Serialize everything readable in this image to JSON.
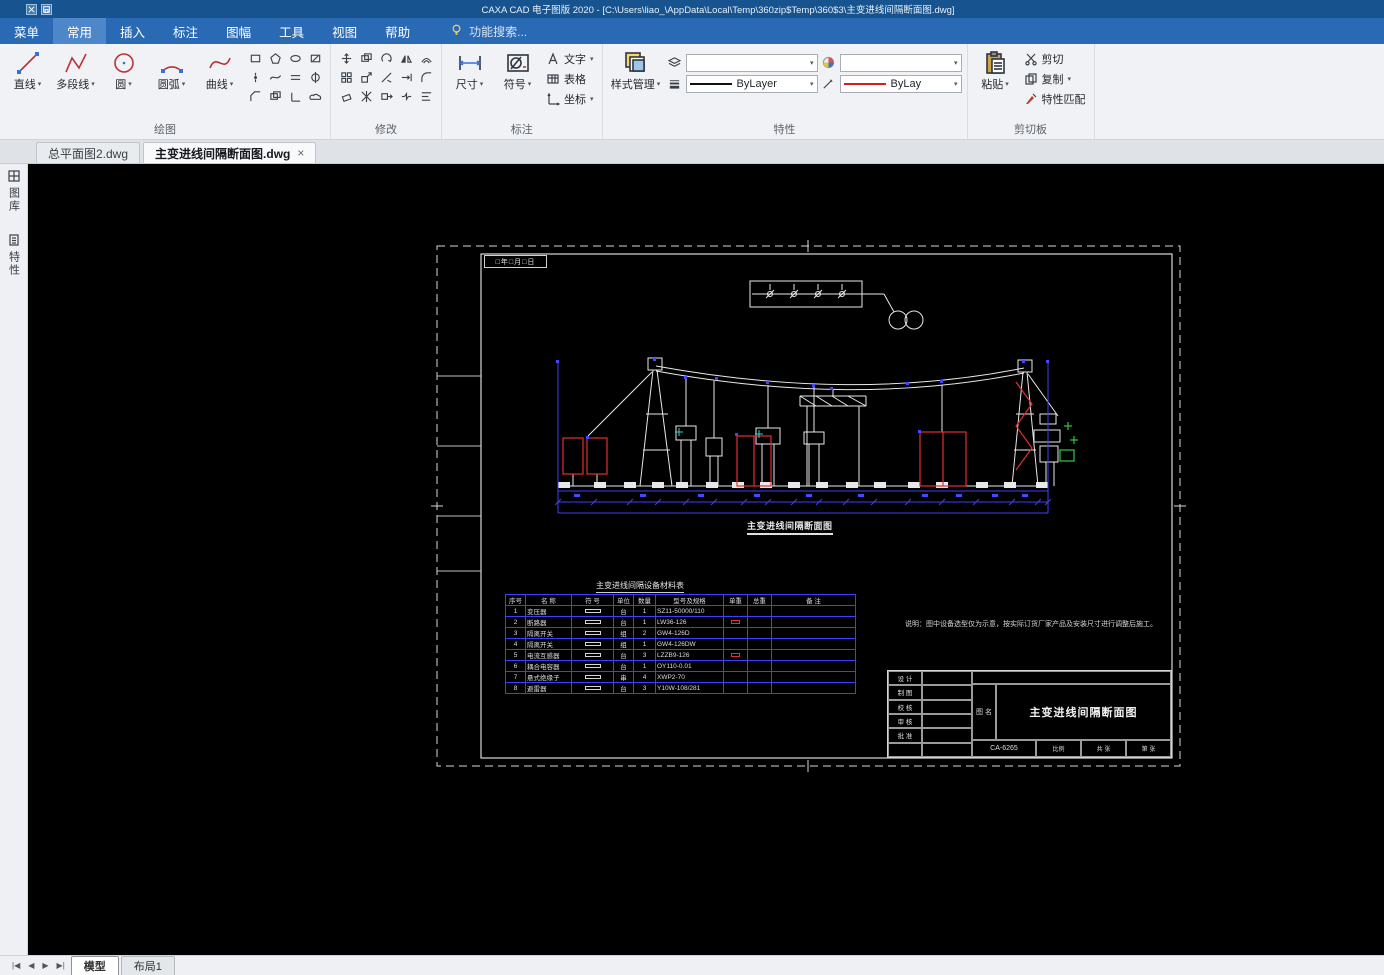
{
  "window": {
    "title": "CAXA CAD 电子图版 2020 - [C:\\Users\\liao_\\AppData\\Local\\Temp\\360zip$Temp\\360$3\\主变进线间隔断面图.dwg]"
  },
  "colors": {
    "titlebar": "#17548f",
    "menubar": "#2a69b4",
    "canvas": "#000000",
    "cad_white": "#e8e8e8",
    "cad_blue": "#3e3eff",
    "cad_red": "#e23030",
    "cad_green": "#2ecc40",
    "bylayer_line": "#111111",
    "bylayer_red": "#d42020"
  },
  "menubar": {
    "items": [
      {
        "label": "菜单",
        "active": false
      },
      {
        "label": "常用",
        "active": true
      },
      {
        "label": "插入",
        "active": false
      },
      {
        "label": "标注",
        "active": false
      },
      {
        "label": "图幅",
        "active": false
      },
      {
        "label": "工具",
        "active": false
      },
      {
        "label": "视图",
        "active": false
      },
      {
        "label": "帮助",
        "active": false
      }
    ],
    "search_label": "功能搜索..."
  },
  "ribbon": {
    "groups": {
      "draw": {
        "label": "绘图",
        "tools": {
          "line": "直线",
          "polyline": "多段线",
          "circle": "圆",
          "arc": "圆弧",
          "curve": "曲线"
        }
      },
      "modify": {
        "label": "修改"
      },
      "annotate": {
        "label": "标注",
        "tools": {
          "dimension": "尺寸",
          "symbol": "符号",
          "text": "文字",
          "table": "表格",
          "coordinate": "坐标"
        }
      },
      "properties": {
        "label": "特性",
        "style_manager": "样式管理",
        "linetype_value": "ByLayer",
        "color_value": "ByLay"
      },
      "clipboard": {
        "label": "剪切板",
        "paste": "粘贴",
        "cut": "剪切",
        "copy": "复制",
        "match": "特性匹配"
      }
    }
  },
  "doc_tabs": [
    {
      "label": "总平面图2.dwg",
      "active": false
    },
    {
      "label": "主变进线间隔断面图.dwg",
      "active": true,
      "close": "×"
    }
  ],
  "side_panel": {
    "library": "图库",
    "properties": "特性"
  },
  "drawing": {
    "stamp": "□年□月□日",
    "section_title": "主变进线间隔断面图",
    "table_title": "主变进线间隔设备材料表",
    "note": "说明：图中设备选型仅为示意，按实际订货厂家产品及安装尺寸进行调整后施工。",
    "table": {
      "headers": [
        "序号",
        "名 称",
        "符 号",
        "单位",
        "数量",
        "型号及规格",
        "单重",
        "总重",
        "备 注"
      ],
      "rows": [
        {
          "no": "1",
          "name": "变压器",
          "unit": "台",
          "qty": "1",
          "spec": "SZ11-50000/110",
          "mark": false
        },
        {
          "no": "2",
          "name": "断路器",
          "unit": "台",
          "qty": "1",
          "spec": "LW36-126",
          "mark": true
        },
        {
          "no": "3",
          "name": "隔离开关",
          "unit": "组",
          "qty": "2",
          "spec": "GW4-126D",
          "mark": false
        },
        {
          "no": "4",
          "name": "隔离开关",
          "unit": "组",
          "qty": "1",
          "spec": "GW4-126DW",
          "mark": false
        },
        {
          "no": "5",
          "name": "电流互感器",
          "unit": "台",
          "qty": "3",
          "spec": "LZZB9-126",
          "mark": true
        },
        {
          "no": "6",
          "name": "耦合电容器",
          "unit": "台",
          "qty": "1",
          "spec": "OY110-0.01",
          "mark": false
        },
        {
          "no": "7",
          "name": "悬式绝缘子",
          "unit": "串",
          "qty": "4",
          "spec": "XWP2-70",
          "mark": false
        },
        {
          "no": "8",
          "name": "避雷器",
          "unit": "台",
          "qty": "3",
          "spec": "Y10W-108/281",
          "mark": false
        }
      ]
    },
    "title_block": {
      "rows": [
        "设 计",
        "制 图",
        "校 核",
        "审 核",
        "批 准"
      ],
      "name_label": "图 名",
      "drawing_name": "主变进线间隔断面图",
      "number": "CA-6265",
      "scale_label": "比例",
      "sheet_total": "共 张",
      "sheet_no": "第 张"
    }
  },
  "bottom_bar": {
    "nav": [
      "|◀",
      "◀",
      "▶",
      "▶|"
    ],
    "tabs": [
      {
        "label": "模型",
        "active": true
      },
      {
        "label": "布局1",
        "active": false
      }
    ]
  }
}
